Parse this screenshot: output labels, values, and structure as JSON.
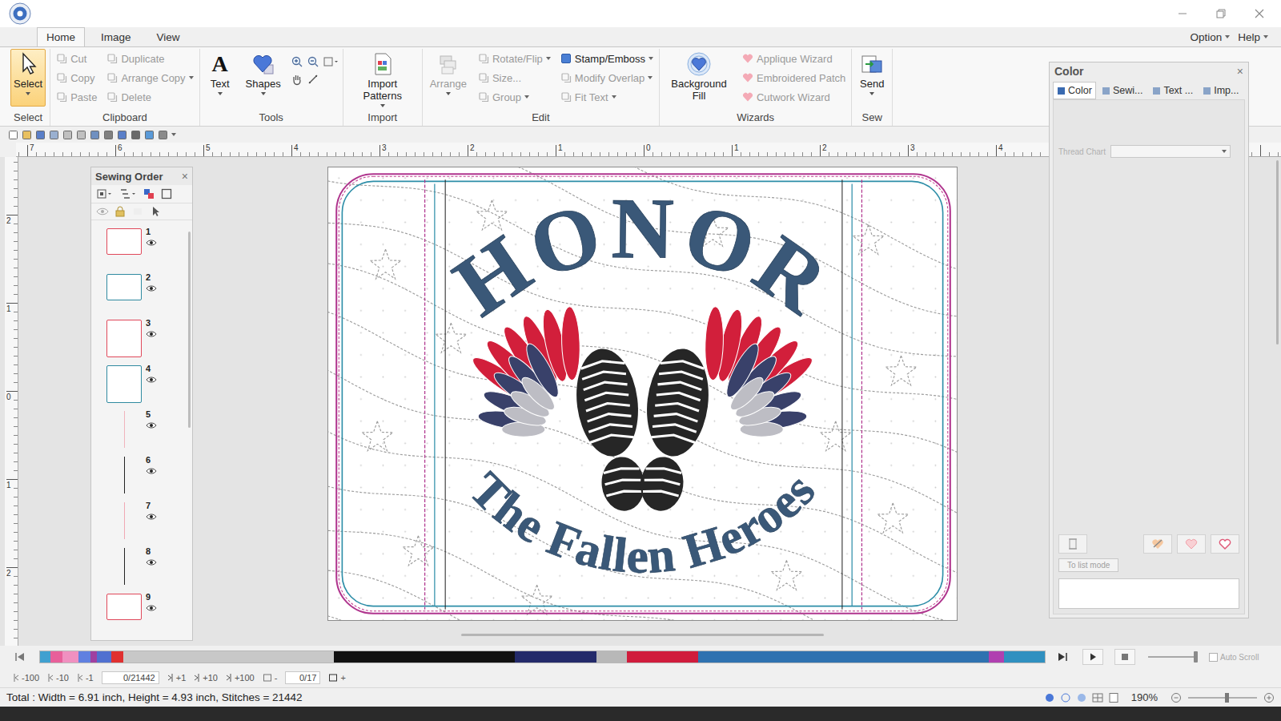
{
  "menu": {
    "tabs": [
      {
        "label": "Home",
        "selected": true
      },
      {
        "label": "Image",
        "selected": false
      },
      {
        "label": "View",
        "selected": false
      }
    ],
    "right": [
      {
        "label": "Option",
        "dropdown": true
      },
      {
        "label": "Help",
        "dropdown": true
      }
    ]
  },
  "ribbon": [
    {
      "label": "Select",
      "zoom_tools": false,
      "items": [
        {
          "label": "Select",
          "kind": "large",
          "disabled": false,
          "selected": true,
          "dropdown": true
        }
      ]
    },
    {
      "label": "Clipboard",
      "zoom_tools": false,
      "items": [
        {
          "label": "Cut",
          "kind": "small",
          "disabled": true,
          "selected": false,
          "dropdown": false
        },
        {
          "label": "Copy",
          "kind": "small",
          "disabled": true,
          "selected": false,
          "dropdown": false
        },
        {
          "label": "Paste",
          "kind": "small",
          "disabled": true,
          "selected": false,
          "dropdown": false
        },
        {
          "label": "Duplicate",
          "kind": "small",
          "disabled": true,
          "selected": false,
          "dropdown": false
        },
        {
          "label": "Arrange Copy",
          "kind": "small",
          "disabled": true,
          "selected": false,
          "dropdown": true
        },
        {
          "label": "Delete",
          "kind": "small",
          "disabled": true,
          "selected": false,
          "dropdown": false
        }
      ]
    },
    {
      "label": "Tools",
      "zoom_tools": true,
      "items": [
        {
          "label": "Text",
          "kind": "large",
          "glyph": "A",
          "disabled": false,
          "selected": false,
          "dropdown": true
        },
        {
          "label": "Shapes",
          "kind": "large",
          "disabled": false,
          "selected": false,
          "dropdown": true
        }
      ]
    },
    {
      "label": "Import",
      "zoom_tools": false,
      "items": [
        {
          "label": "Import Patterns",
          "kind": "large",
          "disabled": false,
          "selected": false,
          "dropdown": true
        }
      ]
    },
    {
      "label": "Edit",
      "zoom_tools": false,
      "items": [
        {
          "label": "Arrange",
          "kind": "large",
          "disabled": true,
          "selected": false,
          "dropdown": true
        },
        {
          "label": "Rotate/Flip",
          "kind": "small",
          "disabled": true,
          "selected": false,
          "dropdown": true
        },
        {
          "label": "Size...",
          "kind": "small",
          "disabled": true,
          "selected": false,
          "dropdown": false
        },
        {
          "label": "Group",
          "kind": "small",
          "disabled": true,
          "selected": false,
          "dropdown": true
        },
        {
          "label": "Stamp/Emboss",
          "kind": "small",
          "disabled": false,
          "selected": false,
          "dropdown": true
        },
        {
          "label": "Modify Overlap",
          "kind": "small",
          "disabled": true,
          "selected": false,
          "dropdown": true
        },
        {
          "label": "Fit Text",
          "kind": "small",
          "disabled": true,
          "selected": false,
          "dropdown": true
        }
      ]
    },
    {
      "label": "Wizards",
      "zoom_tools": false,
      "items": [
        {
          "label": "Background Fill",
          "kind": "large",
          "disabled": false,
          "selected": false,
          "dropdown": false
        },
        {
          "label": "Applique Wizard",
          "kind": "small",
          "disabled": true,
          "selected": false,
          "dropdown": false
        },
        {
          "label": "Embroidered Patch",
          "kind": "small",
          "disabled": true,
          "selected": false,
          "dropdown": false
        },
        {
          "label": "Cutwork Wizard",
          "kind": "small",
          "disabled": true,
          "selected": false,
          "dropdown": false
        }
      ]
    },
    {
      "label": "Sew",
      "zoom_tools": false,
      "items": [
        {
          "label": "Send",
          "kind": "large",
          "disabled": false,
          "selected": false,
          "dropdown": true
        }
      ]
    }
  ],
  "rulers": {
    "horizontal": [
      "7",
      "6",
      "5",
      "4",
      "3",
      "2",
      "1",
      "0",
      "1",
      "2",
      "3",
      "4"
    ],
    "vertical": [
      "2",
      "1",
      "0",
      "1",
      "2"
    ]
  },
  "sewing_order": {
    "title": "Sewing Order",
    "close": "×",
    "items": [
      {
        "number": "1",
        "kind": "frame",
        "color": "#e0485a",
        "visible": true
      },
      {
        "number": "2",
        "kind": "frame",
        "color": "#2f8aa0",
        "visible": true
      },
      {
        "number": "3",
        "kind": "panel",
        "color": "#e0485a",
        "visible": true
      },
      {
        "number": "4",
        "kind": "panel",
        "color": "#2f8aa0",
        "visible": true
      },
      {
        "number": "5",
        "kind": "line",
        "color": "#f0b4bc",
        "visible": true
      },
      {
        "number": "6",
        "kind": "line",
        "color": "#222222",
        "visible": true
      },
      {
        "number": "7",
        "kind": "line",
        "color": "#f0a8b4",
        "visible": true
      },
      {
        "number": "8",
        "kind": "line",
        "color": "#222222",
        "visible": true
      },
      {
        "number": "9",
        "kind": "frame",
        "color": "#e0485a",
        "visible": true
      }
    ]
  },
  "design": {
    "top_text": "HONOR",
    "bottom_text": "The Fallen Heroes"
  },
  "color_panel": {
    "title": "Color",
    "close": "×",
    "tabs": [
      {
        "label": "Color",
        "selected": true
      },
      {
        "label": "Sewi...",
        "selected": false
      },
      {
        "label": "Text ...",
        "selected": false
      },
      {
        "label": "Imp...",
        "selected": false
      }
    ],
    "thread_chart": {
      "label": "Thread Chart",
      "value": "",
      "disabled": true
    },
    "list_mode_button": {
      "label": "To list mode",
      "disabled": true
    }
  },
  "simulator": {
    "segments": [
      {
        "color": "#40a0d0",
        "level": 0.01
      },
      {
        "color": "#e8609a",
        "level": 0.012
      },
      {
        "color": "#f090c0",
        "level": 0.016
      },
      {
        "color": "#6080e0",
        "level": 0.012
      },
      {
        "color": "#a040a0",
        "level": 0.007
      },
      {
        "color": "#5070d0",
        "level": 0.014
      },
      {
        "color": "#e03030",
        "level": 0.012
      },
      {
        "color": "#c8c8c8",
        "level": 0.21
      },
      {
        "color": "#111111",
        "level": 0.18
      },
      {
        "color": "#232a6a",
        "level": 0.081
      },
      {
        "color": "#b8b8b8",
        "level": 0.031
      },
      {
        "color": "#d01c3c",
        "level": 0.071
      },
      {
        "color": "#2f72b0",
        "level": 0.289
      },
      {
        "color": "#b040b0",
        "level": 0.015
      },
      {
        "color": "#3090c0",
        "level": 0.041
      }
    ],
    "speed_level": 0.95,
    "auto_scroll": {
      "label": "Auto Scroll",
      "checked": false,
      "disabled": true
    }
  },
  "stitch_nav": {
    "back": [
      "-100",
      "-10",
      "-1"
    ],
    "stitch_counter": "0/21442",
    "forward": [
      "+1",
      "+10",
      "+100"
    ],
    "color_back": "-",
    "color_counter": "0/17",
    "color_forward": "+"
  },
  "status": {
    "text": "Total : Width = 6.91 inch, Height = 4.93 inch, Stitches = 21442",
    "zoom": "190%",
    "zoom_level": 0.58
  }
}
